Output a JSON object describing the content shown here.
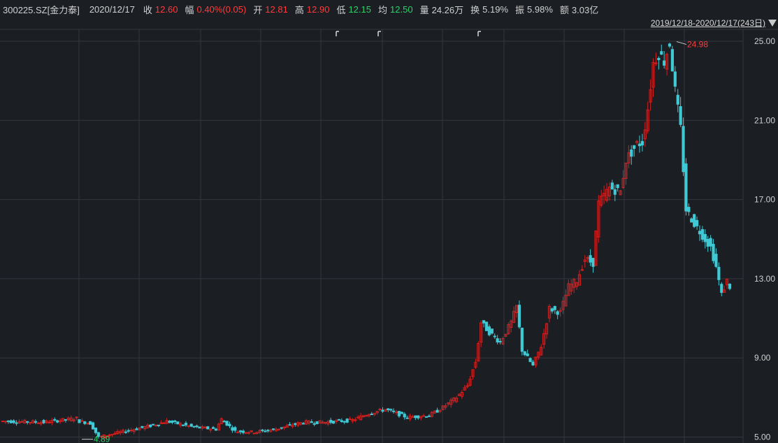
{
  "header": {
    "code": "300225.SZ[金力泰]",
    "date": "2020/12/17",
    "close_label": "收",
    "close": "12.60",
    "change_label": "幅",
    "change": "0.40%(0.05)",
    "open_label": "开",
    "open": "12.81",
    "high_label": "高",
    "high": "12.90",
    "low_label": "低",
    "low": "12.15",
    "avg_label": "均",
    "avg": "12.50",
    "volume_label": "量",
    "volume": "24.26万",
    "turnover_label": "换",
    "turnover": "5.19%",
    "amplitude_label": "振",
    "amplitude": "5.98%",
    "amount_label": "额",
    "amount": "3.03亿"
  },
  "range_label": "2019/12/18-2020/12/17(243日)",
  "colors": {
    "background": "#1b1e23",
    "grid": "#34373d",
    "up": "#d32020",
    "down": "#3fc9d4",
    "text_up": "#ff3b3b",
    "text_down": "#2bd16a"
  },
  "chart_data": {
    "type": "candlestick",
    "ylim": [
      4.7,
      25.6
    ],
    "yticks": [
      "25.00",
      "21.00",
      "17.00",
      "13.00",
      "9.00",
      "5.00"
    ],
    "ytick_values": [
      25,
      21,
      17,
      13,
      9,
      5
    ],
    "max_annotation": "24.98",
    "max_value": 24.98,
    "min_annotation": "4.89",
    "min_value": 4.89,
    "trading_days": 243,
    "close_path": [
      [
        0,
        5.8
      ],
      [
        15,
        5.75
      ],
      [
        27,
        5.95
      ],
      [
        28,
        5.8
      ],
      [
        32,
        5.7
      ],
      [
        35,
        5.0
      ],
      [
        45,
        5.3
      ],
      [
        55,
        5.6
      ],
      [
        60,
        5.8
      ],
      [
        70,
        5.5
      ],
      [
        78,
        5.4
      ],
      [
        80,
        5.9
      ],
      [
        85,
        5.3
      ],
      [
        92,
        5.25
      ],
      [
        100,
        5.4
      ],
      [
        110,
        5.75
      ],
      [
        118,
        5.75
      ],
      [
        128,
        5.85
      ],
      [
        134,
        6.2
      ],
      [
        140,
        6.4
      ],
      [
        148,
        6.0
      ],
      [
        156,
        6.1
      ],
      [
        160,
        6.4
      ],
      [
        166,
        7.0
      ],
      [
        170,
        7.6
      ],
      [
        173,
        8.8
      ],
      [
        175,
        10.8
      ],
      [
        178,
        10.3
      ],
      [
        182,
        9.8
      ],
      [
        186,
        10.8
      ],
      [
        188,
        11.6
      ],
      [
        190,
        9.4
      ],
      [
        194,
        8.6
      ],
      [
        197,
        9.6
      ],
      [
        200,
        11.5
      ],
      [
        204,
        11.3
      ],
      [
        207,
        12.6
      ],
      [
        210,
        12.9
      ],
      [
        213,
        14.0
      ],
      [
        216,
        13.8
      ],
      [
        218,
        16.8
      ],
      [
        222,
        17.6
      ],
      [
        226,
        17.4
      ],
      [
        228,
        19.0
      ],
      [
        232,
        19.8
      ],
      [
        234,
        19.9
      ],
      [
        236,
        21.6
      ],
      [
        238,
        23.9
      ],
      [
        240,
        24.4
      ],
      [
        242,
        24.0
      ],
      [
        244,
        24.9
      ],
      [
        246,
        22.5
      ],
      [
        248,
        20.6
      ],
      [
        250,
        16.5
      ],
      [
        253,
        15.8
      ],
      [
        256,
        15.2
      ],
      [
        259,
        14.6
      ],
      [
        261,
        13.6
      ],
      [
        263,
        12.2
      ],
      [
        265,
        12.9
      ],
      [
        266,
        12.6
      ]
    ]
  }
}
